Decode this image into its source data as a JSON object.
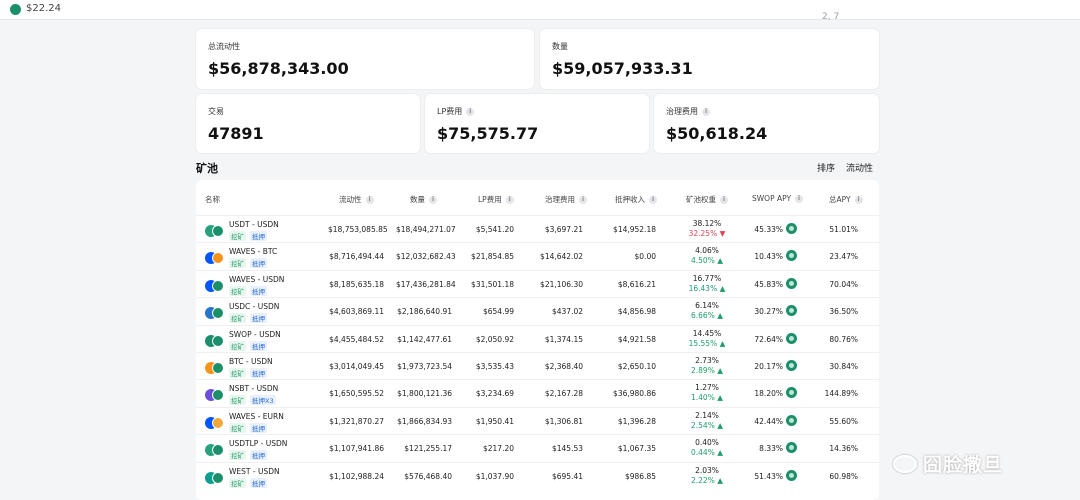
{
  "topbar": {
    "price": "$22.24",
    "right_text": "2, 7"
  },
  "stats": {
    "total_liquidity": {
      "label": "总流动性",
      "value": "$56,878,343.00"
    },
    "volume": {
      "label": "数量",
      "value": "$59,057,933.31"
    },
    "trades": {
      "label": "交易",
      "value": "47891"
    },
    "lp_fees": {
      "label": "LP费用",
      "value": "$75,575.77"
    },
    "gov_fees": {
      "label": "治理费用",
      "value": "$50,618.24"
    }
  },
  "pools": {
    "title": "矿池",
    "sort_label": "排序",
    "sort_value": "流动性",
    "columns": [
      "名称",
      "流动性",
      "数量",
      "LP费用",
      "治理费用",
      "抵押收入",
      "矿池权重",
      "SWOP APY",
      "总APY"
    ],
    "tag_mine": "挖矿",
    "tag_stake": "抵押",
    "tag_stake_x3": "抵押X3",
    "rows": [
      {
        "name": "USDT - USDN",
        "c1": "#26a17b",
        "c2": "#1a8f6a",
        "liquidity": "$18,753,085.85",
        "volume": "$18,494,271.07",
        "lp": "$5,541.20",
        "gov": "$3,697.21",
        "stake": "$14,952.18",
        "w1": "38.12%",
        "w2": "32.25%",
        "dir": "down",
        "swop": "45.33%",
        "total": "51.01%",
        "x3": false
      },
      {
        "name": "WAVES - BTC",
        "c1": "#0055ff",
        "c2": "#f7931a",
        "liquidity": "$8,716,494.44",
        "volume": "$12,032,682.43",
        "lp": "$21,854.85",
        "gov": "$14,642.02",
        "stake": "$0.00",
        "w1": "4.06%",
        "w2": "4.50%",
        "dir": "up",
        "swop": "10.43%",
        "total": "23.47%",
        "x3": false
      },
      {
        "name": "WAVES - USDN",
        "c1": "#0055ff",
        "c2": "#1a8f6a",
        "liquidity": "$8,185,635.18",
        "volume": "$17,436,281.84",
        "lp": "$31,501.18",
        "gov": "$21,106.30",
        "stake": "$8,616.21",
        "w1": "16.77%",
        "w2": "16.43%",
        "dir": "up",
        "swop": "45.83%",
        "total": "70.04%",
        "x3": false
      },
      {
        "name": "USDC - USDN",
        "c1": "#2775ca",
        "c2": "#1a8f6a",
        "liquidity": "$4,603,869.11",
        "volume": "$2,186,640.91",
        "lp": "$654.99",
        "gov": "$437.02",
        "stake": "$4,856.98",
        "w1": "6.14%",
        "w2": "6.66%",
        "dir": "up",
        "swop": "30.27%",
        "total": "36.50%",
        "x3": false
      },
      {
        "name": "SWOP - USDN",
        "c1": "#1a8f6a",
        "c2": "#1a8f6a",
        "liquidity": "$4,455,484.52",
        "volume": "$1,142,477.61",
        "lp": "$2,050.92",
        "gov": "$1,374.15",
        "stake": "$4,921.58",
        "w1": "14.45%",
        "w2": "15.55%",
        "dir": "up",
        "swop": "72.64%",
        "total": "80.76%",
        "x3": false
      },
      {
        "name": "BTC - USDN",
        "c1": "#f7931a",
        "c2": "#1a8f6a",
        "liquidity": "$3,014,049.45",
        "volume": "$1,973,723.54",
        "lp": "$3,535.43",
        "gov": "$2,368.40",
        "stake": "$2,650.10",
        "w1": "2.73%",
        "w2": "2.89%",
        "dir": "up",
        "swop": "20.17%",
        "total": "30.84%",
        "x3": false
      },
      {
        "name": "NSBT - USDN",
        "c1": "#6b4fd8",
        "c2": "#1a8f6a",
        "liquidity": "$1,650,595.52",
        "volume": "$1,800,121.36",
        "lp": "$3,234.69",
        "gov": "$2,167.28",
        "stake": "$36,980.86",
        "w1": "1.27%",
        "w2": "1.40%",
        "dir": "up",
        "swop": "18.20%",
        "total": "144.89%",
        "x3": true
      },
      {
        "name": "WAVES - EURN",
        "c1": "#0055ff",
        "c2": "#f2a93b",
        "liquidity": "$1,321,870.27",
        "volume": "$1,866,834.93",
        "lp": "$1,950.41",
        "gov": "$1,306.81",
        "stake": "$1,396.28",
        "w1": "2.14%",
        "w2": "2.54%",
        "dir": "up",
        "swop": "42.44%",
        "total": "55.60%",
        "x3": false
      },
      {
        "name": "USDTLP - USDN",
        "c1": "#26a17b",
        "c2": "#1a8f6a",
        "liquidity": "$1,107,941.86",
        "volume": "$121,255.17",
        "lp": "$217.20",
        "gov": "$145.53",
        "stake": "$1,067.35",
        "w1": "0.40%",
        "w2": "0.44%",
        "dir": "up",
        "swop": "8.33%",
        "total": "14.36%",
        "x3": false
      },
      {
        "name": "WEST - USDN",
        "c1": "#0a9e8f",
        "c2": "#1a8f6a",
        "liquidity": "$1,102,988.24",
        "volume": "$576,468.40",
        "lp": "$1,037.90",
        "gov": "$695.41",
        "stake": "$986.85",
        "w1": "2.03%",
        "w2": "2.22%",
        "dir": "up",
        "swop": "51.43%",
        "total": "60.98%",
        "x3": false
      }
    ]
  },
  "watermark": {
    "text": "囧脸撒旦"
  }
}
